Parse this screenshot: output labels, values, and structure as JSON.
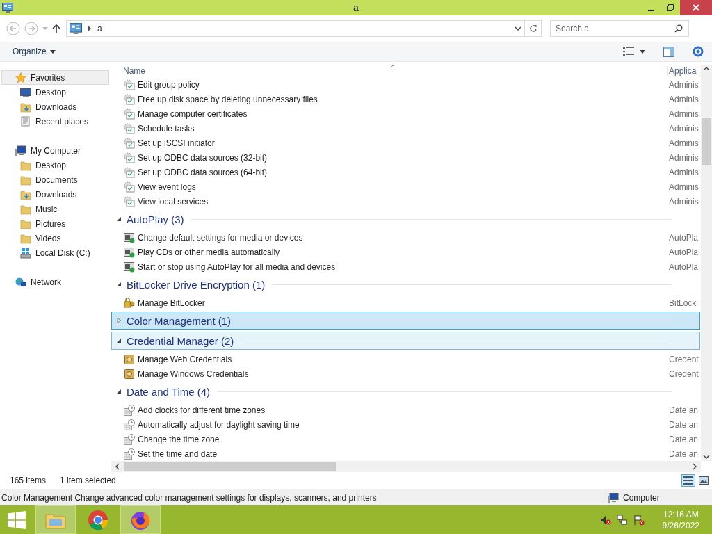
{
  "window": {
    "title": "a"
  },
  "address": {
    "path": "a",
    "search_placeholder": "Search a"
  },
  "toolbar": {
    "organize": "Organize"
  },
  "sidebar": [
    {
      "label": "Favorites",
      "kind": "star",
      "selected": true,
      "children": [
        {
          "label": "Desktop",
          "kind": "desktop",
          "selected": false
        },
        {
          "label": "Downloads",
          "kind": "downloads",
          "selected": false
        },
        {
          "label": "Recent places",
          "kind": "recent",
          "selected": false
        }
      ]
    },
    {
      "label": "My Computer",
      "kind": "computer",
      "selected": false,
      "children": [
        {
          "label": "Desktop",
          "kind": "folder",
          "selected": false
        },
        {
          "label": "Documents",
          "kind": "folder",
          "selected": false
        },
        {
          "label": "Downloads",
          "kind": "downloads",
          "selected": false
        },
        {
          "label": "Music",
          "kind": "folder",
          "selected": false
        },
        {
          "label": "Pictures",
          "kind": "folder",
          "selected": false
        },
        {
          "label": "Videos",
          "kind": "folder",
          "selected": false
        },
        {
          "label": "Local Disk (C:)",
          "kind": "disk",
          "selected": false
        }
      ]
    },
    {
      "label": "Network",
      "kind": "network",
      "selected": false
    }
  ],
  "columns": [
    "Name",
    "Applica"
  ],
  "groups": [
    {
      "kind": "admin",
      "items": [
        {
          "name": "Edit group policy",
          "category": "Adminis"
        },
        {
          "name": "Free up disk space by deleting unnecessary files",
          "category": "Adminis"
        },
        {
          "name": "Manage computer certificates",
          "category": "Adminis"
        },
        {
          "name": "Schedule tasks",
          "category": "Adminis"
        },
        {
          "name": "Set up iSCSI initiator",
          "category": "Adminis"
        },
        {
          "name": "Set up ODBC data sources (32-bit)",
          "category": "Adminis"
        },
        {
          "name": "Set up ODBC data sources (64-bit)",
          "category": "Adminis"
        },
        {
          "name": "View event logs",
          "category": "Adminis"
        },
        {
          "name": "View local services",
          "category": "Adminis"
        }
      ]
    },
    {
      "kind": "autoplay",
      "title": "AutoPlay (3)",
      "expanded": true,
      "selected": false,
      "hovered": false,
      "items": [
        {
          "name": "Change default settings for media or devices",
          "category": "AutoPla"
        },
        {
          "name": "Play CDs or other media automatically",
          "category": "AutoPla"
        },
        {
          "name": "Start or stop using AutoPlay for all media and devices",
          "category": "AutoPla"
        }
      ]
    },
    {
      "kind": "bitlocker",
      "title": "BitLocker Drive Encryption (1)",
      "expanded": true,
      "selected": false,
      "hovered": false,
      "items": [
        {
          "name": "Manage BitLocker",
          "category": "BitLock"
        }
      ]
    },
    {
      "title": "Color Management (1)",
      "expanded": false,
      "selected": true,
      "hovered": false
    },
    {
      "kind": "credential",
      "title": "Credential Manager (2)",
      "expanded": true,
      "selected": false,
      "hovered": true,
      "items": [
        {
          "name": "Manage Web Credentials",
          "category": "Credent"
        },
        {
          "name": "Manage Windows Credentials",
          "category": "Credent"
        }
      ]
    },
    {
      "kind": "clock",
      "title": "Date and Time (4)",
      "expanded": true,
      "selected": false,
      "hovered": false,
      "items": [
        {
          "name": "Add clocks for different time zones",
          "category": "Date an"
        },
        {
          "name": "Automatically adjust for daylight saving time",
          "category": "Date an"
        },
        {
          "name": "Change the time zone",
          "category": "Date an"
        },
        {
          "name": "Set the time and date",
          "category": "Date an"
        }
      ]
    }
  ],
  "status_bar": {
    "count": "165 items",
    "selected": "1 item selected"
  },
  "details_bar": {
    "text": "Color Management Change advanced color management settings for displays, scanners, and printers",
    "location": "Computer"
  },
  "taskbar": {
    "apps": [
      {
        "kind": "explorer",
        "active": true
      },
      {
        "kind": "chrome",
        "active": false
      },
      {
        "kind": "firefox",
        "active": true
      }
    ],
    "time": "12:16 AM",
    "date": "9/26/2022"
  }
}
